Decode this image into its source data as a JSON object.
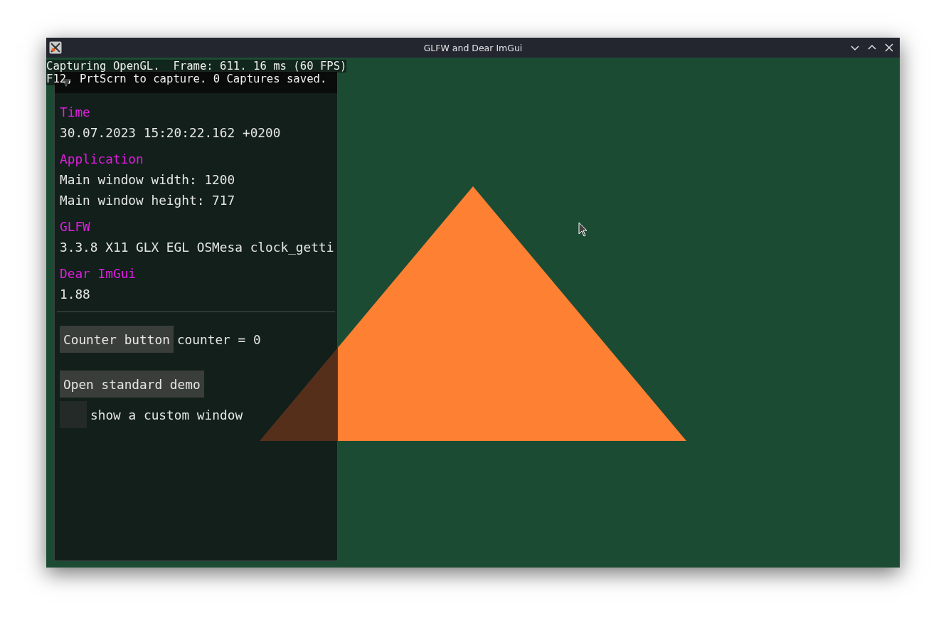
{
  "window": {
    "title": "GLFW and Dear ImGui"
  },
  "capture_overlay": {
    "lines": [
      "Capturing OpenGL.  Frame: 611. 16 ms (60 FPS)",
      "F12, PrtScrn to capture. 0 Captures saved."
    ]
  },
  "panel": {
    "expanded": true,
    "sections": [
      {
        "heading": "Time",
        "lines": [
          "30.07.2023 15:20:22.162 +0200"
        ]
      },
      {
        "heading": "Application",
        "lines": [
          "Main window width: 1200",
          "Main window height: 717"
        ]
      },
      {
        "heading": "GLFW",
        "lines": [
          "3.3.8 X11 GLX EGL OSMesa clock_getti"
        ]
      },
      {
        "heading": "Dear ImGui",
        "lines": [
          "1.88"
        ]
      }
    ],
    "counter_button": "Counter button",
    "counter_text": "counter = 0",
    "demo_button": "Open standard demo",
    "checkbox": {
      "label": "show a custom window",
      "checked": false
    }
  }
}
